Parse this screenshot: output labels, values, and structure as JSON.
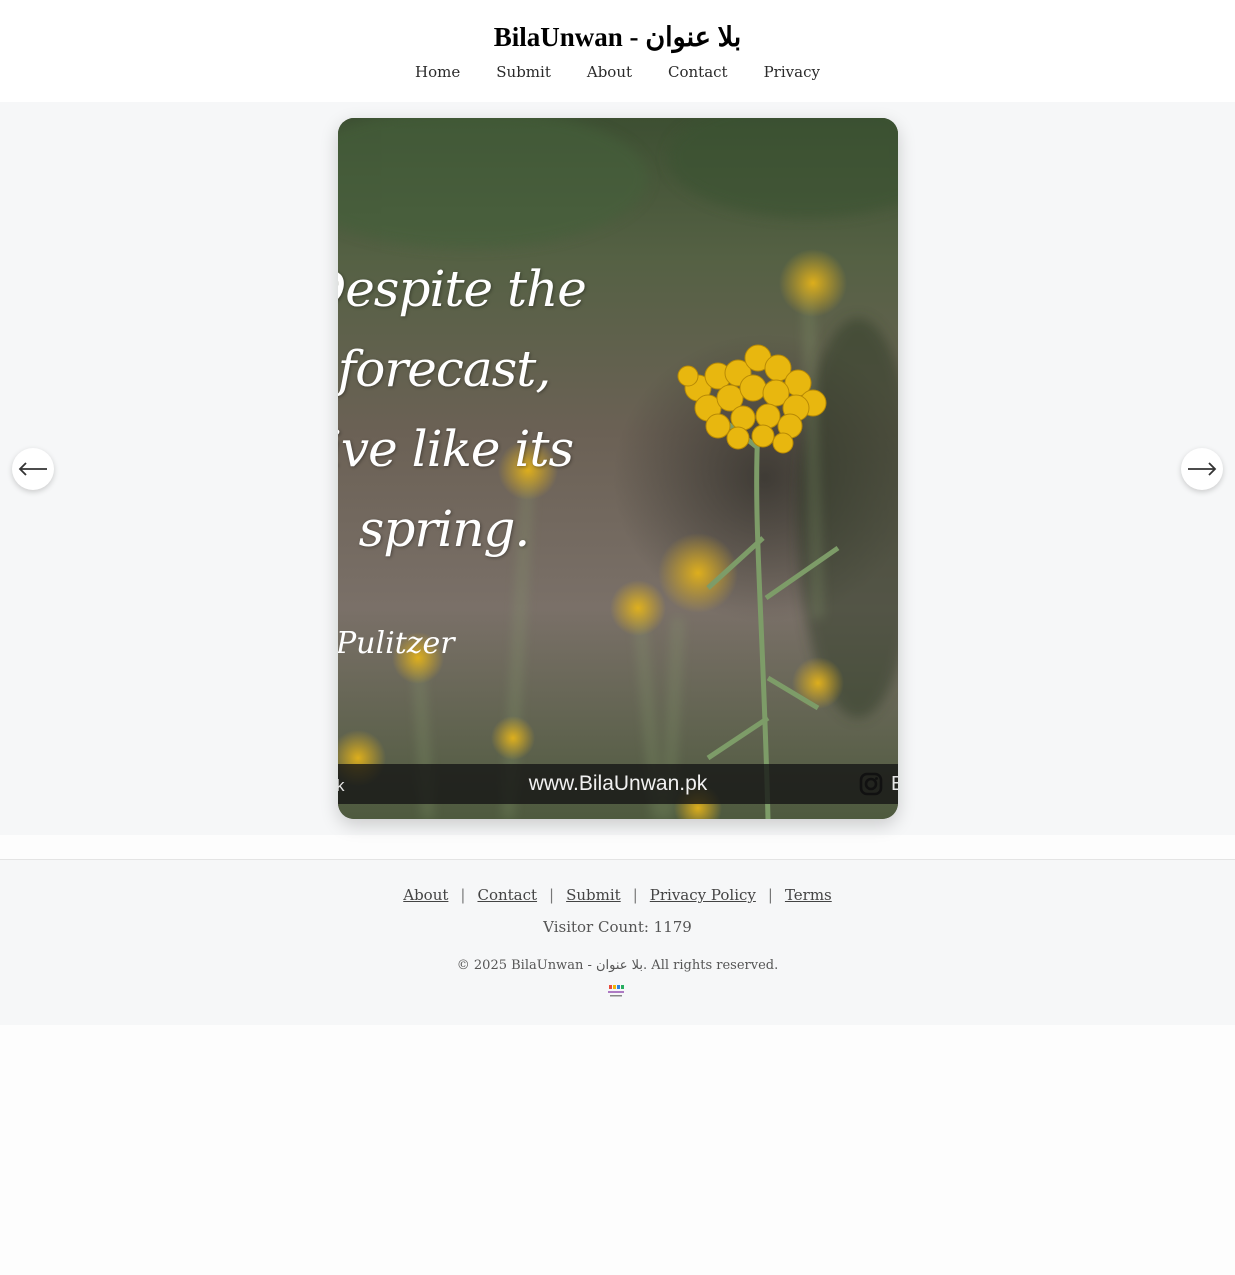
{
  "header": {
    "title": "BilaUnwan - بلا عنوان",
    "nav": [
      "Home",
      "Submit",
      "About",
      "Contact",
      "Privacy"
    ]
  },
  "slide": {
    "quote_lines": [
      "Despite the",
      "forecast,",
      "live like its",
      "spring."
    ],
    "author_fragment": "Pulitzer",
    "watermark": "www.BilaUnwan.pk",
    "watermark_left_fragment": "k",
    "watermark_right_fragment": "B",
    "watermark_icon": "instagram-icon"
  },
  "controls": {
    "prev_icon": "arrow-left-icon",
    "next_icon": "arrow-right-icon"
  },
  "footer": {
    "links": [
      "About",
      "Contact",
      "Submit",
      "Privacy Policy",
      "Terms"
    ],
    "separator": "|",
    "visitor_count": "Visitor Count: 1179",
    "copyright": "© 2025 BilaUnwan - بلا عنوان. All rights reserved."
  },
  "colors": {
    "page_bg": "#f6f7f8",
    "flower_yellow": "#e8b70f",
    "text": "#333333"
  }
}
